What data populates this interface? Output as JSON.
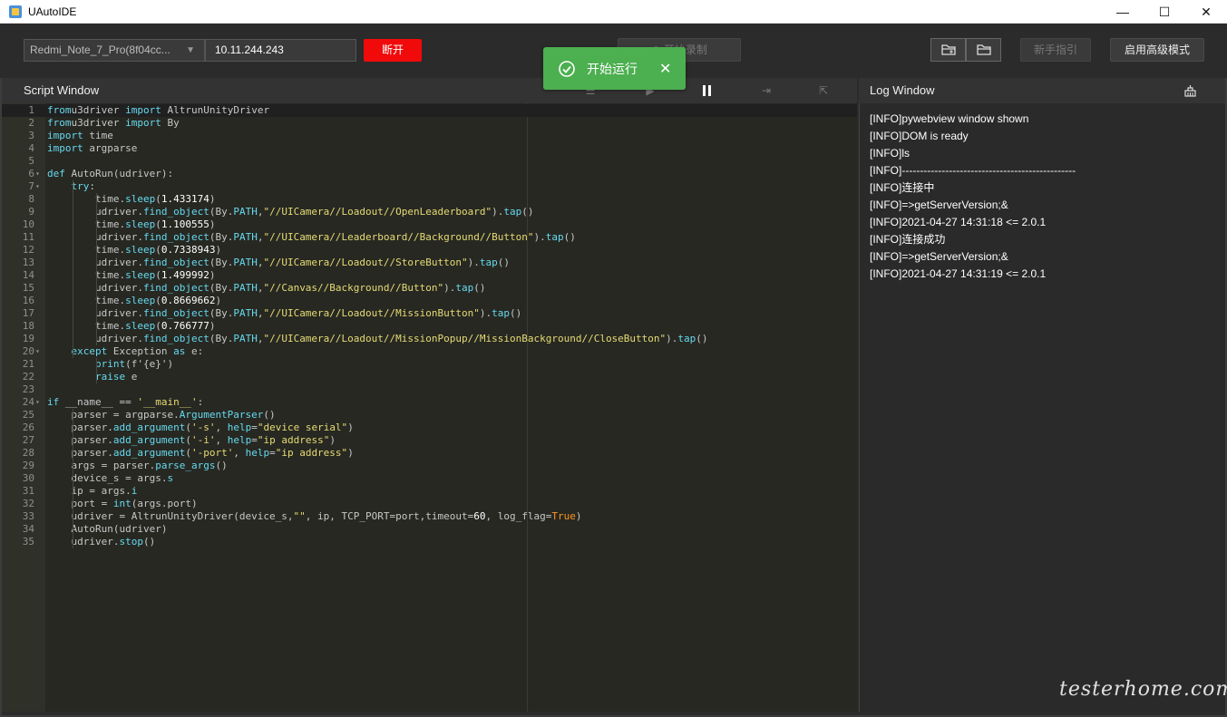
{
  "window": {
    "title": "UAutoIDE",
    "minimize": "—",
    "maximize": "☐",
    "close": "✕"
  },
  "toolbar": {
    "device": "Redmi_Note_7_Pro(8f04cc...",
    "ip": "10.11.244.243",
    "disconnect_label": "断开",
    "record_label": "开始录制",
    "guide_label": "新手指引",
    "advanced_label": "启用高级模式"
  },
  "toast": {
    "text": "开始运行"
  },
  "script_window": {
    "title": "Script Window"
  },
  "log_window": {
    "title": "Log Window",
    "lines": [
      "[INFO]pywebview window shown",
      "[INFO]DOM is ready",
      "[INFO]ls",
      "[INFO]------------------------------------------------",
      "[INFO]连接中",
      "[INFO]=>getServerVersion;&",
      "[INFO]2021-04-27 14:31:18 <= 2.0.1",
      "[INFO]连接成功",
      "[INFO]=>getServerVersion;&",
      "[INFO]2021-04-27 14:31:19 <= 2.0.1"
    ]
  },
  "editor": {
    "lines": [
      {
        "n": "1",
        "fold": "",
        "segs": [
          [
            "kw",
            "from"
          ],
          [
            "",
            "u3driver "
          ],
          [
            "kw",
            "import"
          ],
          [
            "",
            " AltrunUnityDriver"
          ]
        ]
      },
      {
        "n": "2",
        "fold": "",
        "segs": [
          [
            "kw",
            "from"
          ],
          [
            "",
            "u3driver "
          ],
          [
            "kw",
            "import"
          ],
          [
            "",
            " By"
          ]
        ]
      },
      {
        "n": "3",
        "fold": "",
        "segs": [
          [
            "kw",
            "import"
          ],
          [
            "",
            " time"
          ]
        ]
      },
      {
        "n": "4",
        "fold": "",
        "segs": [
          [
            "kw",
            "import"
          ],
          [
            "",
            " argparse"
          ]
        ]
      },
      {
        "n": "5",
        "fold": "",
        "segs": []
      },
      {
        "n": "6",
        "fold": "▾",
        "segs": [
          [
            "kw",
            "def"
          ],
          [
            "",
            " AutoRun(udriver):"
          ]
        ]
      },
      {
        "n": "7",
        "fold": "▾",
        "segs": [
          [
            "",
            "    "
          ],
          [
            "kw",
            "try"
          ],
          [
            "",
            ":"
          ]
        ]
      },
      {
        "n": "8",
        "fold": "",
        "segs": [
          [
            "",
            "        time."
          ],
          [
            "fn",
            "sleep"
          ],
          [
            "",
            "("
          ],
          [
            "num",
            "1.433174"
          ],
          [
            "",
            ")"
          ]
        ]
      },
      {
        "n": "9",
        "fold": "",
        "segs": [
          [
            "",
            "        udriver."
          ],
          [
            "fn",
            "find_object"
          ],
          [
            "",
            "(By."
          ],
          [
            "fn",
            "PATH"
          ],
          [
            "",
            ","
          ],
          [
            "str",
            "\"//UICamera//Loadout//OpenLeaderboard\""
          ],
          [
            "",
            ")."
          ],
          [
            "fn",
            "tap"
          ],
          [
            "",
            "()"
          ]
        ]
      },
      {
        "n": "10",
        "fold": "",
        "segs": [
          [
            "",
            "        time."
          ],
          [
            "fn",
            "sleep"
          ],
          [
            "",
            "("
          ],
          [
            "num",
            "1.100555"
          ],
          [
            "",
            ")"
          ]
        ]
      },
      {
        "n": "11",
        "fold": "",
        "segs": [
          [
            "",
            "        udriver."
          ],
          [
            "fn",
            "find_object"
          ],
          [
            "",
            "(By."
          ],
          [
            "fn",
            "PATH"
          ],
          [
            "",
            ","
          ],
          [
            "str",
            "\"//UICamera//Leaderboard//Background//Button\""
          ],
          [
            "",
            ")."
          ],
          [
            "fn",
            "tap"
          ],
          [
            "",
            "()"
          ]
        ]
      },
      {
        "n": "12",
        "fold": "",
        "segs": [
          [
            "",
            "        time."
          ],
          [
            "fn",
            "sleep"
          ],
          [
            "",
            "("
          ],
          [
            "num",
            "0.7338943"
          ],
          [
            "",
            ")"
          ]
        ]
      },
      {
        "n": "13",
        "fold": "",
        "segs": [
          [
            "",
            "        udriver."
          ],
          [
            "fn",
            "find_object"
          ],
          [
            "",
            "(By."
          ],
          [
            "fn",
            "PATH"
          ],
          [
            "",
            ","
          ],
          [
            "str",
            "\"//UICamera//Loadout//StoreButton\""
          ],
          [
            "",
            ")."
          ],
          [
            "fn",
            "tap"
          ],
          [
            "",
            "()"
          ]
        ]
      },
      {
        "n": "14",
        "fold": "",
        "segs": [
          [
            "",
            "        time."
          ],
          [
            "fn",
            "sleep"
          ],
          [
            "",
            "("
          ],
          [
            "num",
            "1.499992"
          ],
          [
            "",
            ")"
          ]
        ]
      },
      {
        "n": "15",
        "fold": "",
        "segs": [
          [
            "",
            "        udriver."
          ],
          [
            "fn",
            "find_object"
          ],
          [
            "",
            "(By."
          ],
          [
            "fn",
            "PATH"
          ],
          [
            "",
            ","
          ],
          [
            "str",
            "\"//Canvas//Background//Button\""
          ],
          [
            "",
            ")."
          ],
          [
            "fn",
            "tap"
          ],
          [
            "",
            "()"
          ]
        ]
      },
      {
        "n": "16",
        "fold": "",
        "segs": [
          [
            "",
            "        time."
          ],
          [
            "fn",
            "sleep"
          ],
          [
            "",
            "("
          ],
          [
            "num",
            "0.8669662"
          ],
          [
            "",
            ")"
          ]
        ]
      },
      {
        "n": "17",
        "fold": "",
        "segs": [
          [
            "",
            "        udriver."
          ],
          [
            "fn",
            "find_object"
          ],
          [
            "",
            "(By."
          ],
          [
            "fn",
            "PATH"
          ],
          [
            "",
            ","
          ],
          [
            "str",
            "\"//UICamera//Loadout//MissionButton\""
          ],
          [
            "",
            ")."
          ],
          [
            "fn",
            "tap"
          ],
          [
            "",
            "()"
          ]
        ]
      },
      {
        "n": "18",
        "fold": "",
        "segs": [
          [
            "",
            "        time."
          ],
          [
            "fn",
            "sleep"
          ],
          [
            "",
            "("
          ],
          [
            "num",
            "0.766777"
          ],
          [
            "",
            ")"
          ]
        ]
      },
      {
        "n": "19",
        "fold": "",
        "segs": [
          [
            "",
            "        udriver."
          ],
          [
            "fn",
            "find_object"
          ],
          [
            "",
            "(By."
          ],
          [
            "fn",
            "PATH"
          ],
          [
            "",
            ","
          ],
          [
            "str",
            "\"//UICamera//Loadout//MissionPopup//MissionBackground//CloseButton\""
          ],
          [
            "",
            ")."
          ],
          [
            "fn",
            "tap"
          ],
          [
            "",
            "()"
          ]
        ]
      },
      {
        "n": "20",
        "fold": "▾",
        "segs": [
          [
            "",
            "    "
          ],
          [
            "kw",
            "except"
          ],
          [
            "",
            " Exception "
          ],
          [
            "kw",
            "as"
          ],
          [
            "",
            " e:"
          ]
        ]
      },
      {
        "n": "21",
        "fold": "",
        "segs": [
          [
            "",
            "        "
          ],
          [
            "fn",
            "print"
          ],
          [
            "",
            "(f'{e}')"
          ]
        ]
      },
      {
        "n": "22",
        "fold": "",
        "segs": [
          [
            "",
            "        "
          ],
          [
            "kw",
            "raise"
          ],
          [
            "",
            " e"
          ]
        ]
      },
      {
        "n": "23",
        "fold": "",
        "segs": []
      },
      {
        "n": "24",
        "fold": "▾",
        "segs": [
          [
            "kw",
            "if"
          ],
          [
            "",
            " __name__ == "
          ],
          [
            "str",
            "'__main__'"
          ],
          [
            "",
            ":"
          ]
        ]
      },
      {
        "n": "25",
        "fold": "",
        "segs": [
          [
            "",
            "    parser = argparse."
          ],
          [
            "fn",
            "ArgumentParser"
          ],
          [
            "",
            "()"
          ]
        ]
      },
      {
        "n": "26",
        "fold": "",
        "segs": [
          [
            "",
            "    parser."
          ],
          [
            "fn",
            "add_argument"
          ],
          [
            "",
            "("
          ],
          [
            "str",
            "'-s'"
          ],
          [
            "",
            ", "
          ],
          [
            "fn",
            "help"
          ],
          [
            "",
            "="
          ],
          [
            "str",
            "\"device serial\""
          ],
          [
            "",
            ")"
          ]
        ]
      },
      {
        "n": "27",
        "fold": "",
        "segs": [
          [
            "",
            "    parser."
          ],
          [
            "fn",
            "add_argument"
          ],
          [
            "",
            "("
          ],
          [
            "str",
            "'-i'"
          ],
          [
            "",
            ", "
          ],
          [
            "fn",
            "help"
          ],
          [
            "",
            "="
          ],
          [
            "str",
            "\"ip address\""
          ],
          [
            "",
            ")"
          ]
        ]
      },
      {
        "n": "28",
        "fold": "",
        "segs": [
          [
            "",
            "    parser."
          ],
          [
            "fn",
            "add_argument"
          ],
          [
            "",
            "("
          ],
          [
            "str",
            "'-port'"
          ],
          [
            "",
            ", "
          ],
          [
            "fn",
            "help"
          ],
          [
            "",
            "="
          ],
          [
            "str",
            "\"ip address\""
          ],
          [
            "",
            ")"
          ]
        ]
      },
      {
        "n": "29",
        "fold": "",
        "segs": [
          [
            "",
            "    args = parser."
          ],
          [
            "fn",
            "parse_args"
          ],
          [
            "",
            "()"
          ]
        ]
      },
      {
        "n": "30",
        "fold": "",
        "segs": [
          [
            "",
            "    device_s = args."
          ],
          [
            "fn",
            "s"
          ]
        ]
      },
      {
        "n": "31",
        "fold": "",
        "segs": [
          [
            "",
            "    ip = args."
          ],
          [
            "fn",
            "i"
          ]
        ]
      },
      {
        "n": "32",
        "fold": "",
        "segs": [
          [
            "",
            "    port = "
          ],
          [
            "fn",
            "int"
          ],
          [
            "",
            "(args.port)"
          ]
        ]
      },
      {
        "n": "33",
        "fold": "",
        "segs": [
          [
            "",
            "    udriver = AltrunUnityDriver(device_s,"
          ],
          [
            "str",
            "\"\""
          ],
          [
            "",
            ", ip, TCP_PORT=port,timeout="
          ],
          [
            "num",
            "60"
          ],
          [
            "",
            ", log_flag="
          ],
          [
            "const",
            "True"
          ],
          [
            "",
            ")"
          ]
        ]
      },
      {
        "n": "34",
        "fold": "",
        "segs": [
          [
            "",
            "    AutoRun(udriver)"
          ]
        ]
      },
      {
        "n": "35",
        "fold": "",
        "segs": [
          [
            "",
            "    udriver."
          ],
          [
            "fn",
            "stop"
          ],
          [
            "",
            "()"
          ]
        ]
      }
    ]
  },
  "watermark": "testerhome.com"
}
